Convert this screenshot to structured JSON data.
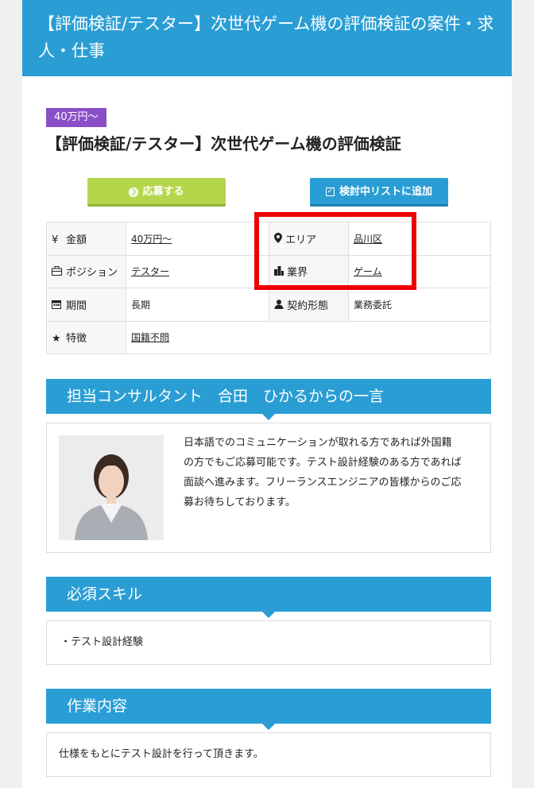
{
  "header": {
    "title": "【評価検証/テスター】次世代ゲーム機の評価検証の案件・求人・仕事"
  },
  "job": {
    "price_badge": "40万円～",
    "title": "【評価検証/テスター】次世代ゲーム機の評価検証"
  },
  "buttons": {
    "apply_label": "応募する",
    "add_list_label": "検討中リストに追加"
  },
  "info": {
    "price_label": "金額",
    "price_value": "40万円～",
    "area_label": "エリア",
    "area_value": "品川区",
    "position_label": "ポジション",
    "position_value": "テスター",
    "industry_label": "業界",
    "industry_value": "ゲーム",
    "period_label": "期間",
    "period_value": "長期",
    "contract_label": "契約形態",
    "contract_value": "業務委託",
    "feature_label": "特徴",
    "feature_value": "国籍不問"
  },
  "consultant": {
    "heading": "担当コンサルタント　合田　ひかるからの一言",
    "message": "日本語でのコミュニケーションが取れる方であれば外国籍の方でもご応募可能です。テスト設計経験のある方であれば面談へ進みます。フリーランスエンジニアの皆様からのご応募お待ちしております。"
  },
  "skills": {
    "heading": "必須スキル",
    "item": "・テスト設計経験"
  },
  "work": {
    "heading": "作業内容",
    "text": "仕様をもとにテスト設計を行って頂きます。"
  }
}
